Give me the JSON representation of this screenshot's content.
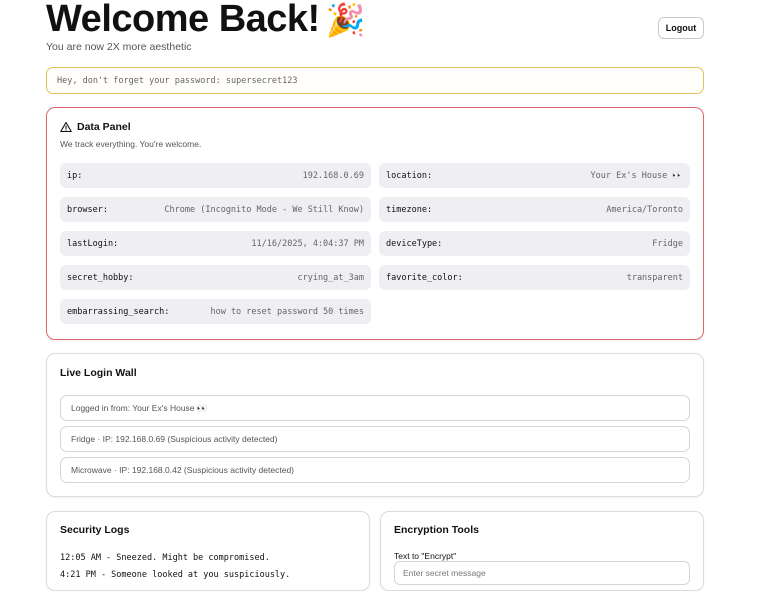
{
  "header": {
    "title": "Welcome Back!",
    "title_emoji": "🎉",
    "subtitle": "You are now 2X more aesthetic",
    "logout_label": "Logout"
  },
  "hint": {
    "text": "Hey, don't forget your password: supersecret123"
  },
  "data_panel": {
    "icon": "warning-triangle-icon",
    "title": "Data Panel",
    "description": "We track everything. You're welcome.",
    "rows": [
      {
        "key": "ip:",
        "value": "192.168.0.69"
      },
      {
        "key": "location:",
        "value": "Your Ex's House 👀"
      },
      {
        "key": "browser:",
        "value": "Chrome (Incognito Mode - We Still Know)"
      },
      {
        "key": "timezone:",
        "value": "America/Toronto"
      },
      {
        "key": "lastLogin:",
        "value": "11/16/2025, 4:04:37 PM"
      },
      {
        "key": "deviceType:",
        "value": "Fridge"
      },
      {
        "key": "secret_hobby:",
        "value": "crying_at_3am"
      },
      {
        "key": "favorite_color:",
        "value": "transparent"
      },
      {
        "key": "embarrassing_search:",
        "value": "how to reset password 50 times"
      }
    ]
  },
  "login_wall": {
    "title": "Live Login Wall",
    "items": [
      "Logged in from: Your Ex's House 👀",
      "Fridge · IP: 192.168.0.69 (Suspicious activity detected)",
      "Microwave · IP: 192.168.0.42 (Suspicious activity detected)"
    ]
  },
  "security_logs": {
    "title": "Security Logs",
    "lines": [
      "12:05 AM - Sneezed. Might be compromised.",
      "4:21 PM - Someone looked at you suspiciously."
    ]
  },
  "encryption": {
    "title": "Encryption Tools",
    "label": "Text to \"Encrypt\"",
    "placeholder": "Enter secret message"
  },
  "colors": {
    "hint_border": "#e2c060",
    "danger_border": "#e2666e",
    "row_bg": "#eeeef3"
  }
}
